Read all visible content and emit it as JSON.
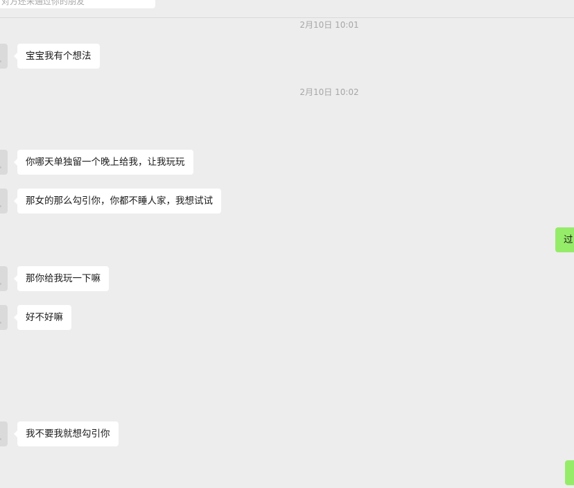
{
  "top_preview": {
    "text": "对方还未通过你的朋友",
    "chevron": "›"
  },
  "messages": [
    {
      "type": "time",
      "text": "2月10日 10:01"
    },
    {
      "type": "in",
      "text": "宝宝我有个想法"
    },
    {
      "type": "time",
      "text": "2月10日 10:02"
    },
    {
      "type": "in",
      "text": "你哪天单独留一个晚上给我，让我玩玩"
    },
    {
      "type": "in",
      "text": "那女的那么勾引你，你都不睡人家，我想试试"
    },
    {
      "type": "out",
      "text": "过"
    },
    {
      "type": "in",
      "text": "那你给我玩一下嘛"
    },
    {
      "type": "in",
      "text": "好不好嘛"
    },
    {
      "type": "in",
      "text": "我不要我就想勾引你"
    },
    {
      "type": "out",
      "text": ""
    }
  ],
  "colors": {
    "background": "#ededed",
    "incoming_bubble": "#ffffff",
    "outgoing_bubble": "#95ec69",
    "timestamp_text": "#a6a6a6"
  }
}
